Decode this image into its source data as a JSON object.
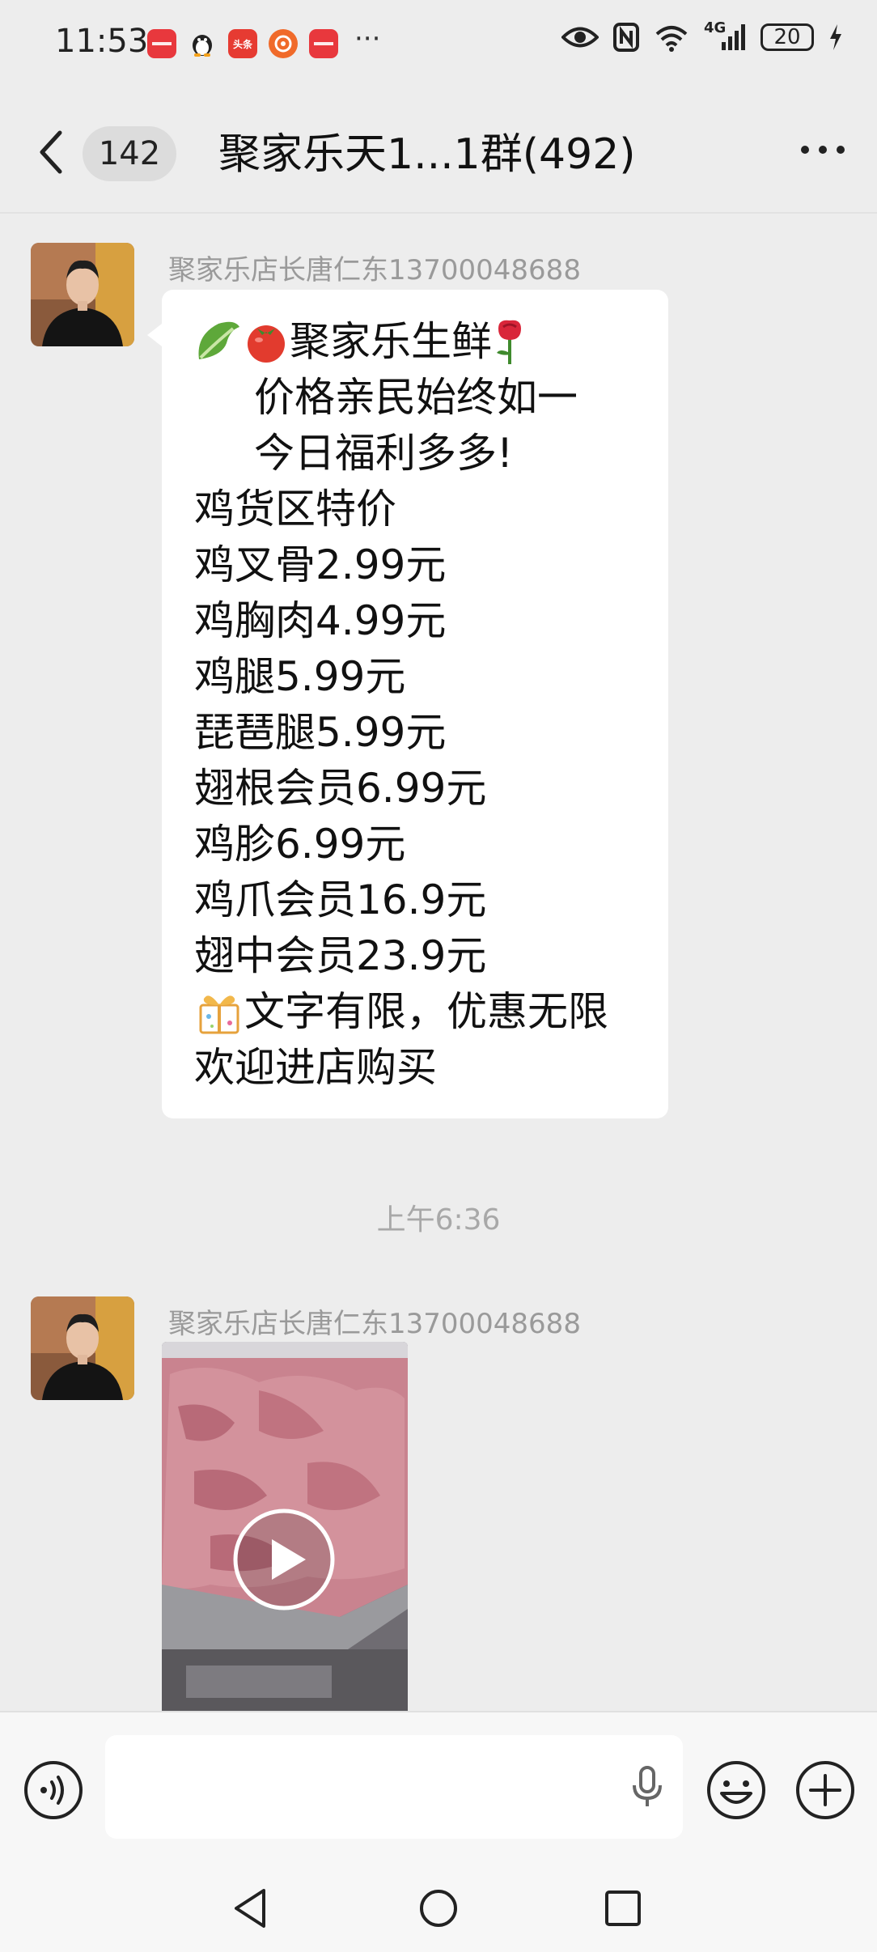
{
  "status_bar": {
    "time": "11:53",
    "apps": [
      {
        "icon": "huawei-app-icon",
        "label": "HUAWEI",
        "color": "#e8383d"
      },
      {
        "icon": "penguin-app-icon",
        "label": "",
        "color": "#f2f2f2"
      },
      {
        "icon": "toutiao-app-icon",
        "label": "头条",
        "color": "#e63b32"
      },
      {
        "icon": "weibo-app-icon",
        "label": "",
        "color": "#f06a2a"
      },
      {
        "icon": "huawei-app-icon",
        "label": "HUAWEI",
        "color": "#e8383d"
      }
    ],
    "more": "···",
    "network_label": "4G",
    "battery": "20"
  },
  "header": {
    "unread_count": "142",
    "title": "聚家乐天1...1群(492)"
  },
  "messages": [
    {
      "sender": "聚家乐店长唐仁东13700048688",
      "headline": "聚家乐生鲜",
      "lines": [
        "价格亲民始终如一",
        "今日福利多多!",
        "鸡货区特价",
        "鸡叉骨2.99元",
        "鸡胸肉4.99元",
        "鸡腿5.99元",
        "琵琶腿5.99元",
        "翅根会员6.99元",
        "鸡胗6.99元",
        "鸡爪会员16.9元",
        "翅中会员23.9元",
        "文字有限，优惠无限",
        "欢迎进店购买"
      ]
    },
    {
      "sender": "聚家乐店长唐仁东13700048688",
      "type": "video"
    }
  ],
  "timestamp": "上午6:36",
  "colors": {
    "background": "#ededed",
    "bubble": "#ffffff",
    "sender_text": "#9a9a9a"
  }
}
